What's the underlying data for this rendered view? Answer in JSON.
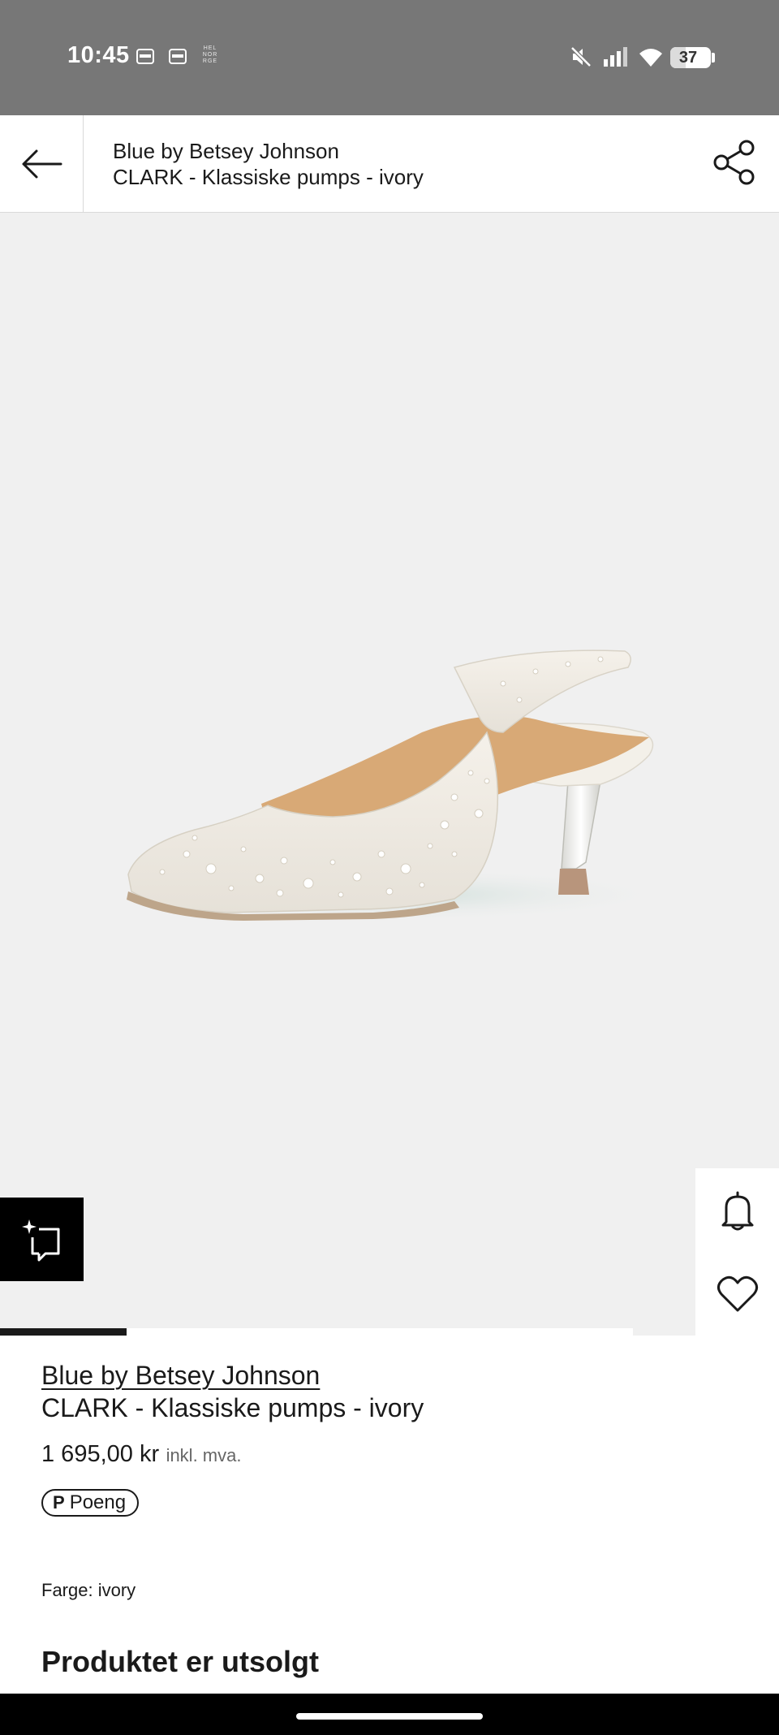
{
  "status_bar": {
    "time": "10:45",
    "tiny_label": "HEL NOR RGE",
    "battery": "37",
    "battery_level": 0.37,
    "icons": [
      "notification-icon",
      "notification-icon",
      "mute-icon",
      "signal-icon",
      "wifi-icon",
      "battery-icon"
    ]
  },
  "header": {
    "back_icon": "arrow-left-icon",
    "brand": "Blue by Betsey Johnson",
    "title": "CLARK - Klassiske pumps - ivory",
    "share_icon": "share-icon"
  },
  "gallery": {
    "image_alt": "Ivory pearl-embellished slingback pump",
    "image_index": 1,
    "image_count": 5,
    "ai_icon": "sparkle-chat-icon",
    "notify_icon": "bell-icon",
    "wishlist_icon": "heart-icon"
  },
  "product": {
    "brand": "Blue by Betsey Johnson",
    "name": "CLARK - Klassiske pumps - ivory",
    "price": "1 695,00 kr",
    "vat_note": "inkl. mva.",
    "points_symbol": "P",
    "points_label": "Poeng",
    "color_label": "Farge: ivory",
    "soldout": "Produktet er utsolgt"
  },
  "colors": {
    "status_bar_bg": "#777777",
    "image_bg": "#f0f0f0",
    "text": "#1a1a1a",
    "nav_bar": "#000000"
  }
}
